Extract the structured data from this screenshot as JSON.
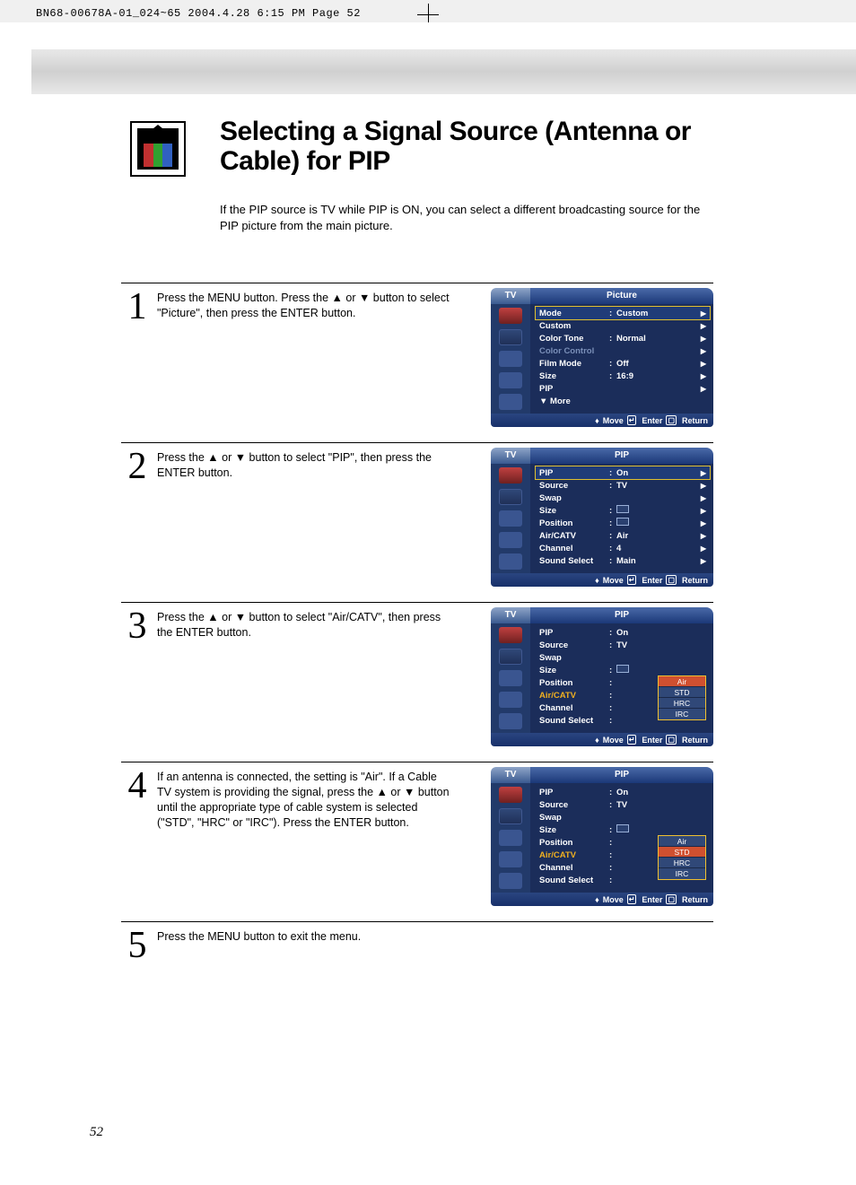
{
  "print_header": "BN68-00678A-01_024~65  2004.4.28  6:15 PM  Page 52",
  "title": "Selecting a Signal Source (Antenna or Cable) for PIP",
  "intro": "If the PIP source is TV while PIP is ON, you can select a different broadcasting source for the PIP picture from the main picture.",
  "page_number": "52",
  "steps": [
    {
      "num": "1",
      "text": "Press the MENU button. Press the ▲ or ▼ button to select \"Picture\", then press the ENTER button."
    },
    {
      "num": "2",
      "text": "Press the ▲ or ▼ button to select \"PIP\", then press the ENTER button."
    },
    {
      "num": "3",
      "text": "Press the ▲ or ▼ button to select \"Air/CATV\", then press the ENTER button."
    },
    {
      "num": "4",
      "text": "If an antenna is connected, the setting is \"Air\". If a Cable TV system is providing the signal, press the ▲ or ▼ button until the appropriate type of cable system is selected (\"STD\", \"HRC\" or \"IRC\"). Press the ENTER button."
    },
    {
      "num": "5",
      "text": "Press the MENU button to exit the menu."
    }
  ],
  "osd_common": {
    "tv_label": "TV",
    "footer_move": "Move",
    "footer_enter": "Enter",
    "footer_return": "Return"
  },
  "osd1": {
    "title": "Picture",
    "rows": {
      "mode_l": "Mode",
      "mode_v": "Custom",
      "custom_l": "Custom",
      "colortone_l": "Color Tone",
      "colortone_v": "Normal",
      "colorctrl_l": "Color Control",
      "film_l": "Film Mode",
      "film_v": "Off",
      "size_l": "Size",
      "size_v": "16:9",
      "pip_l": "PIP",
      "more_l": "▼ More"
    }
  },
  "osd2": {
    "title": "PIP",
    "rows": {
      "pip_l": "PIP",
      "pip_v": "On",
      "source_l": "Source",
      "source_v": "TV",
      "swap_l": "Swap",
      "size_l": "Size",
      "pos_l": "Position",
      "air_l": "Air/CATV",
      "air_v": "Air",
      "ch_l": "Channel",
      "ch_v": "4",
      "snd_l": "Sound Select",
      "snd_v": "Main"
    }
  },
  "osd3": {
    "title": "PIP",
    "rows": {
      "pip_l": "PIP",
      "pip_v": "On",
      "source_l": "Source",
      "source_v": "TV",
      "swap_l": "Swap",
      "size_l": "Size",
      "pos_l": "Position",
      "air_l": "Air/CATV",
      "ch_l": "Channel",
      "snd_l": "Sound Select"
    },
    "options": [
      "Air",
      "STD",
      "HRC",
      "IRC"
    ],
    "selected": "Air"
  },
  "osd4": {
    "title": "PIP",
    "rows": {
      "pip_l": "PIP",
      "pip_v": "On",
      "source_l": "Source",
      "source_v": "TV",
      "swap_l": "Swap",
      "size_l": "Size",
      "pos_l": "Position",
      "air_l": "Air/CATV",
      "ch_l": "Channel",
      "snd_l": "Sound Select"
    },
    "options": [
      "Air",
      "STD",
      "HRC",
      "IRC"
    ],
    "selected": "STD"
  }
}
